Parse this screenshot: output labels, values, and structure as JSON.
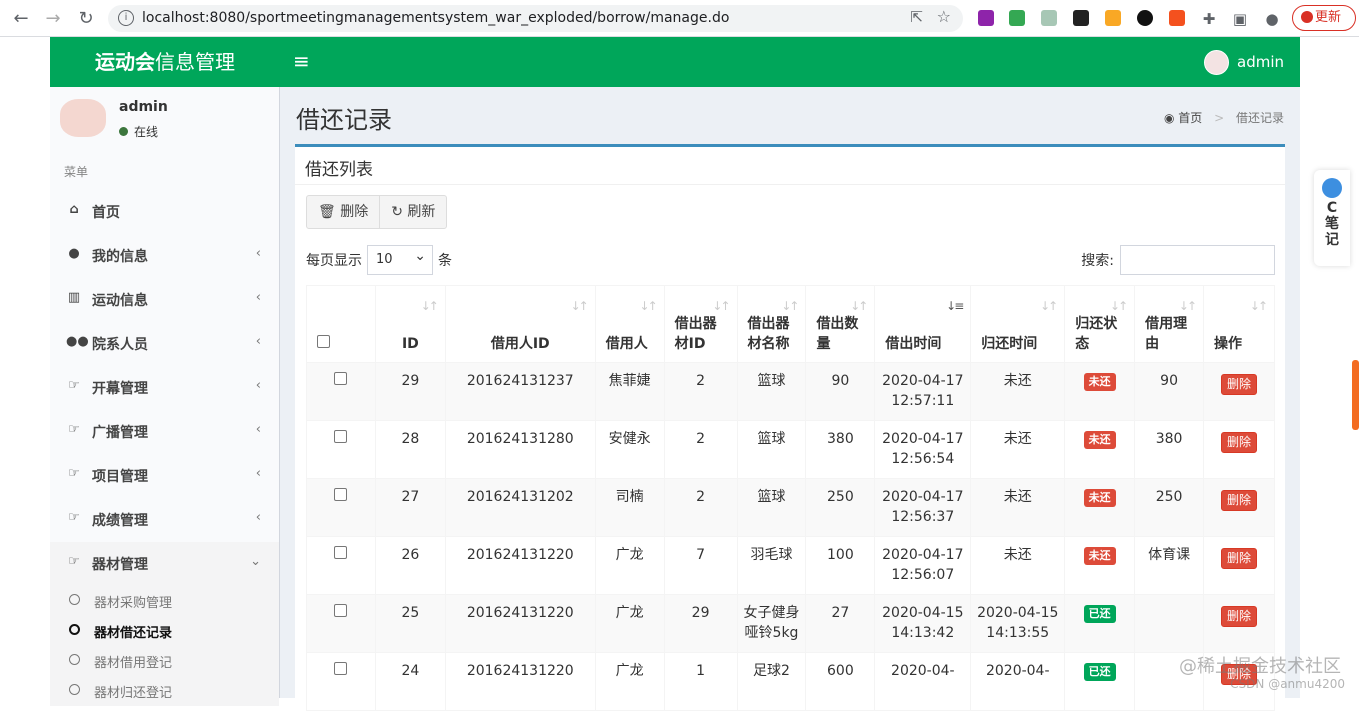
{
  "browser": {
    "url": "localhost:8080/sportmeetingmanagementsystem_war_exploded/borrow/manage.do",
    "update": "更新"
  },
  "header": {
    "logo_bold": "运动会",
    "logo_rest": "信息管理",
    "toggle": "≡",
    "user": "admin"
  },
  "sidebar": {
    "user": "admin",
    "status": "在线",
    "menu_header": "菜单",
    "items": [
      {
        "icon": "home-icon",
        "glyph": "⌂",
        "label": "首页",
        "chevron": ""
      },
      {
        "icon": "user-icon",
        "glyph": "●",
        "label": "我的信息",
        "chevron": "‹"
      },
      {
        "icon": "bar-chart-icon",
        "glyph": "▥",
        "label": "运动信息",
        "chevron": "‹"
      },
      {
        "icon": "users-icon",
        "glyph": "●●",
        "label": "院系人员",
        "chevron": "‹"
      },
      {
        "icon": "hand-point-icon",
        "glyph": "☞",
        "label": "开幕管理",
        "chevron": "‹"
      },
      {
        "icon": "hand-point-icon",
        "glyph": "☞",
        "label": "广播管理",
        "chevron": "‹"
      },
      {
        "icon": "hand-point-icon",
        "glyph": "☞",
        "label": "项目管理",
        "chevron": "‹"
      },
      {
        "icon": "hand-point-icon",
        "glyph": "☞",
        "label": "成绩管理",
        "chevron": "‹"
      },
      {
        "icon": "hand-point-icon",
        "glyph": "☞",
        "label": "器材管理",
        "chevron": "⌄"
      }
    ],
    "sub_items": [
      "器材采购管理",
      "器材借还记录",
      "器材借用登记",
      "器材归还登记"
    ]
  },
  "content": {
    "title": "借还记录",
    "breadcrumb": {
      "home": "首页",
      "sep": ">",
      "current": "借还记录"
    },
    "box_title": "借还列表",
    "buttons": {
      "delete": "🗑 删除",
      "refresh": "↻ 刷新"
    },
    "length": {
      "prefix": "每页显示",
      "value": "10",
      "suffix": "条"
    },
    "search_label": "搜索:",
    "columns": [
      "",
      "ID",
      "借用人ID",
      "借用人",
      "借出器材ID",
      "借出器材名称",
      "借出数量",
      "借出时间",
      "归还时间",
      "归还状态",
      "借用理由",
      "操作"
    ],
    "rows": [
      {
        "id": "29",
        "uid": "201624131237",
        "name": "焦菲婕",
        "eid": "2",
        "ename": "篮球",
        "qty": "90",
        "out": "2020-04-17 12:57:11",
        "back": "未还",
        "status": "未还",
        "reason": "90",
        "op": "删除"
      },
      {
        "id": "28",
        "uid": "201624131280",
        "name": "安健永",
        "eid": "2",
        "ename": "篮球",
        "qty": "380",
        "out": "2020-04-17 12:56:54",
        "back": "未还",
        "status": "未还",
        "reason": "380",
        "op": "删除"
      },
      {
        "id": "27",
        "uid": "201624131202",
        "name": "司楠",
        "eid": "2",
        "ename": "篮球",
        "qty": "250",
        "out": "2020-04-17 12:56:37",
        "back": "未还",
        "status": "未还",
        "reason": "250",
        "op": "删除"
      },
      {
        "id": "26",
        "uid": "201624131220",
        "name": "广龙",
        "eid": "7",
        "ename": "羽毛球",
        "qty": "100",
        "out": "2020-04-17 12:56:07",
        "back": "未还",
        "status": "未还",
        "reason": "体育课",
        "op": "删除"
      },
      {
        "id": "25",
        "uid": "201624131220",
        "name": "广龙",
        "eid": "29",
        "ename": "女子健身哑铃5kg",
        "qty": "27",
        "out": "2020-04-15 14:13:42",
        "back": "2020-04-15 14:13:55",
        "status": "已还",
        "reason": "",
        "op": "删除"
      },
      {
        "id": "24",
        "uid": "201624131220",
        "name": "广龙",
        "eid": "1",
        "ename": "足球2",
        "qty": "600",
        "out": "2020-04-",
        "back": "2020-04-",
        "status": "已还",
        "reason": "",
        "op": "删除"
      }
    ]
  },
  "widget": {
    "text": "C笔记"
  },
  "watermark": {
    "line1": "@稀土掘金技术社区",
    "line2": "CSDN @anmu4200"
  },
  "colors": {
    "header_green": "#00a65a",
    "box_top": "#3c8dbc",
    "danger": "#dd4b39",
    "success": "#00a65a"
  }
}
